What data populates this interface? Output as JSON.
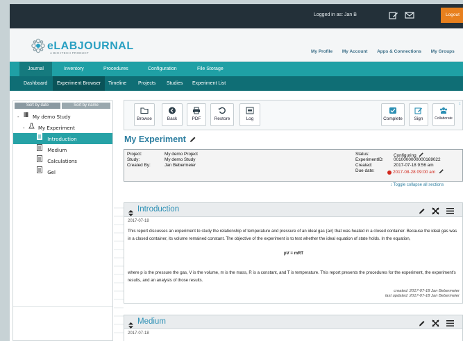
{
  "header": {
    "logged_in": "Logged in as: Jan B",
    "logout": "Logout"
  },
  "brand": {
    "name_bold": "eLABJOURNAL",
    "sub": "A BIO-ITECH PRODUCT",
    "links": [
      "My Profile",
      "My Account",
      "Apps & Connections",
      "My Groups"
    ]
  },
  "nav": {
    "primary": [
      "Journal",
      "Inventory",
      "Procedures",
      "Configuration",
      "File Storage"
    ],
    "secondary": [
      "Dashboard",
      "Experiment Browser",
      "Timeline",
      "Projects",
      "Studies",
      "Experiment List"
    ]
  },
  "sidebar": {
    "sort_date": "Sort by date",
    "sort_name": "Sort by name",
    "tree": [
      {
        "label": "My demo Study",
        "level": 0
      },
      {
        "label": "My Experiment",
        "level": 1
      },
      {
        "label": "Introduction",
        "level": 2,
        "selected": true
      },
      {
        "label": "Medium",
        "level": 2
      },
      {
        "label": "Calculations",
        "level": 2
      },
      {
        "label": "Gel",
        "level": 2
      }
    ]
  },
  "toolbar": {
    "browse": "Browse",
    "back": "Back",
    "pdf": "PDF",
    "restore": "Restore",
    "log": "Log",
    "complete": "Complete",
    "sign": "Sign",
    "collaborate": "Collaborate"
  },
  "experiment": {
    "title": "My Experiment",
    "project_label": "Project:",
    "project": "My demo Project",
    "study_label": "Study:",
    "study": "My demo Study",
    "created_by_label": "Created By:",
    "created_by": "Jan Bebermeier",
    "status_label": "Status:",
    "status": "Configuring",
    "expid_label": "ExperimentID:",
    "expid": "0010000000000169022",
    "created_label": "Created:",
    "created": "2017-07-18 9:56 am",
    "due_label": "Due date:",
    "due": "2017-08-28 09:00 am",
    "toggle": "↕ Toggle collapse all sections"
  },
  "sections": {
    "intro": {
      "title": "Introduction",
      "date": "2017-07-18",
      "p1": "This report discusses an experiment to study the relationship of temperature and pressure of an ideal gas (air) that was heated in a closed container. Because the ideal gas was in a closed container, its volume remained constant. The objective of the experiment is to test whether the ideal equation of state holds. In the equation,",
      "formula": "pV = mRT",
      "p2": "where p is the pressure the gas, V is the volume, m is the mass, R is a constant, and T is temperature. This report presents the procedures for the experiment, the experiment's results, and an analysis of those results.",
      "created": "created: 2017-07-18 Jan Bebermeier",
      "updated": "last updated: 2017-07-18 Jan Bebermeier"
    },
    "medium": {
      "title": "Medium",
      "date": "2017-07-18"
    }
  },
  "colors": {
    "accent": "#1fa0a5",
    "dark_nav": "#0f6e75",
    "topbar": "#233039",
    "logout": "#e8801e",
    "title": "#2c7ea0",
    "due_red": "#d2281d"
  }
}
